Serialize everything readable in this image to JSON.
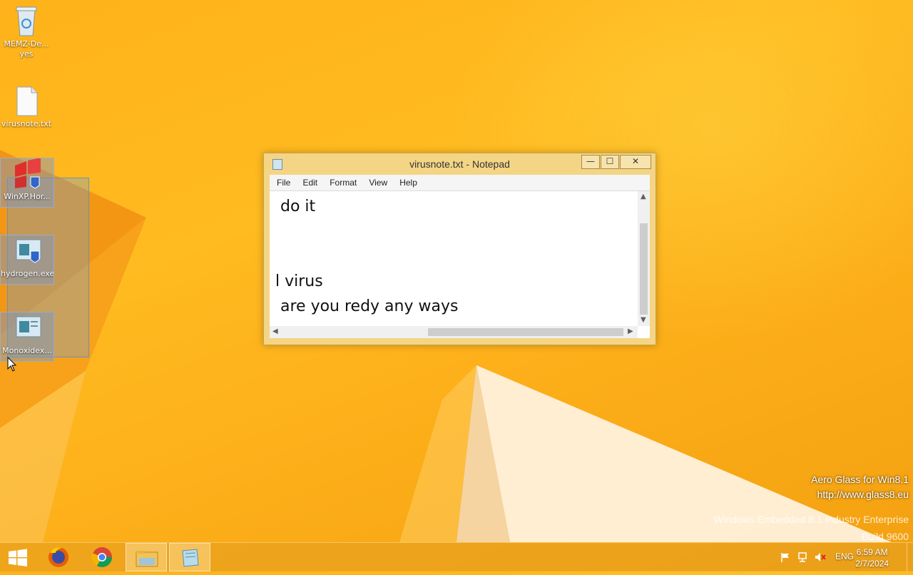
{
  "desktop": {
    "icons": [
      {
        "name": "recycle-bin",
        "label": "MEMZ-De...",
        "label2": "yes"
      },
      {
        "name": "text-file",
        "label": "virusnote.txt"
      },
      {
        "name": "winxp-horror",
        "label": "WinXP.Hor..."
      },
      {
        "name": "hydrogen",
        "label": "hydrogen.exe"
      },
      {
        "name": "monoxide",
        "label": "Monoxidex..."
      }
    ]
  },
  "notepad": {
    "title": "virusnote.txt - Notepad",
    "menu": [
      "File",
      "Edit",
      "Format",
      "View",
      "Help"
    ],
    "content": " do it\n\n\nl virus\n are you redy any ways",
    "buttons": {
      "minimize": "—",
      "maximize": "☐",
      "close": "✕"
    }
  },
  "watermark": {
    "line1": "Aero Glass for Win8.1",
    "line2": "http://www.glass8.eu",
    "line3": "Windows Embedded 8.1 Industry Enterprise",
    "line4": "Build 9600"
  },
  "taskbar": {
    "items": [
      "start",
      "firefox",
      "chrome",
      "file-explorer",
      "notepad"
    ],
    "tray": {
      "language": "ENG",
      "time": "6:59 AM",
      "date": "2/7/2024"
    }
  }
}
